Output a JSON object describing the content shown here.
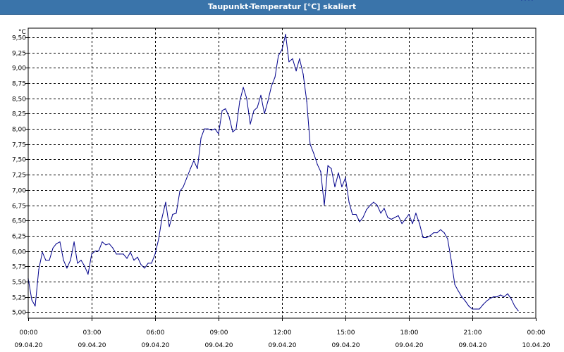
{
  "window": {
    "title": "Taupunkt-Temperatur [°C] skaliert"
  },
  "colors": {
    "titlebar": "#3a74aa",
    "line": "#00008b",
    "grid": "#000000"
  },
  "chart_data": {
    "type": "line",
    "title": "Taupunkt-Temperatur [°C] skaliert",
    "yunit": "°C",
    "ylim": [
      4.9,
      9.65
    ],
    "yticks": [
      "5,00",
      "5,25",
      "5,50",
      "5,75",
      "6,00",
      "6,25",
      "6,50",
      "6,75",
      "7,00",
      "7,25",
      "7,50",
      "7,75",
      "8,00",
      "8,25",
      "8,50",
      "8,75",
      "9,00",
      "9,25",
      "9,50"
    ],
    "ytick_values": [
      5.0,
      5.25,
      5.5,
      5.75,
      6.0,
      6.25,
      6.5,
      6.75,
      7.0,
      7.25,
      7.5,
      7.75,
      8.0,
      8.25,
      8.5,
      8.75,
      9.0,
      9.25,
      9.5
    ],
    "xlim_hours": [
      0,
      24
    ],
    "xticks": [
      {
        "time": "00:00",
        "date": "09.04.20",
        "hour": 0
      },
      {
        "time": "03:00",
        "date": "09.04.20",
        "hour": 3
      },
      {
        "time": "06:00",
        "date": "09.04.20",
        "hour": 6
      },
      {
        "time": "09:00",
        "date": "09.04.20",
        "hour": 9
      },
      {
        "time": "12:00",
        "date": "09.04.20",
        "hour": 12
      },
      {
        "time": "15:00",
        "date": "09.04.20",
        "hour": 15
      },
      {
        "time": "18:00",
        "date": "09.04.20",
        "hour": 18
      },
      {
        "time": "21:00",
        "date": "09.04.20",
        "hour": 21
      },
      {
        "time": "00:00",
        "date": "10.04.20",
        "hour": 24
      }
    ],
    "grid": true,
    "series": [
      {
        "hours": [
          0.0,
          0.17,
          0.33,
          0.5,
          0.67,
          0.83,
          1.0,
          1.17,
          1.33,
          1.5,
          1.67,
          1.83,
          2.0,
          2.17,
          2.33,
          2.5,
          2.67,
          2.83,
          3.0,
          3.17,
          3.33,
          3.5,
          3.67,
          3.83,
          4.0,
          4.17,
          4.33,
          4.5,
          4.67,
          4.83,
          5.0,
          5.17,
          5.33,
          5.5,
          5.67,
          5.83,
          6.0,
          6.17,
          6.33,
          6.5,
          6.67,
          6.83,
          7.0,
          7.17,
          7.33,
          7.5,
          7.67,
          7.83,
          8.0,
          8.17,
          8.33,
          8.5,
          8.67,
          8.83,
          9.0,
          9.17,
          9.33,
          9.5,
          9.67,
          9.83,
          10.0,
          10.17,
          10.33,
          10.5,
          10.67,
          10.83,
          11.0,
          11.17,
          11.33,
          11.5,
          11.67,
          11.83,
          12.0,
          12.17,
          12.33,
          12.5,
          12.67,
          12.83,
          13.0,
          13.17,
          13.33,
          13.5,
          13.67,
          13.83,
          14.0,
          14.17,
          14.33,
          14.5,
          14.67,
          14.83,
          15.0,
          15.17,
          15.33,
          15.5,
          15.67,
          15.83,
          16.0,
          16.17,
          16.33,
          16.5,
          16.67,
          16.83,
          17.0,
          17.17,
          17.33,
          17.5,
          17.67,
          17.83,
          18.0,
          18.17,
          18.33,
          18.5,
          18.67,
          18.83,
          19.0,
          19.17,
          19.33,
          19.5,
          19.67,
          19.83,
          20.0,
          20.17,
          20.33,
          20.5,
          20.67,
          20.83,
          21.0,
          21.17,
          21.33,
          21.5,
          21.67,
          21.83,
          22.0,
          22.17,
          22.33,
          22.5,
          22.67,
          22.83,
          23.0,
          23.17,
          23.33,
          23.5,
          23.67,
          23.83
        ],
        "values": [
          5.55,
          5.2,
          5.1,
          5.7,
          5.98,
          5.85,
          5.85,
          6.05,
          6.12,
          6.15,
          5.85,
          5.72,
          5.85,
          6.15,
          5.8,
          5.85,
          5.75,
          5.62,
          5.95,
          6.0,
          6.0,
          6.15,
          6.1,
          6.12,
          6.05,
          5.95,
          5.95,
          5.95,
          5.88,
          5.98,
          5.85,
          5.9,
          5.78,
          5.72,
          5.8,
          5.8,
          5.95,
          6.2,
          6.55,
          6.8,
          6.4,
          6.6,
          6.62,
          6.98,
          7.05,
          7.2,
          7.35,
          7.48,
          7.35,
          7.85,
          8.0,
          8.0,
          7.98,
          8.0,
          7.92,
          8.3,
          8.33,
          8.2,
          7.95,
          8.0,
          8.45,
          8.68,
          8.5,
          8.08,
          8.3,
          8.35,
          8.55,
          8.25,
          8.45,
          8.7,
          8.85,
          9.2,
          9.3,
          9.55,
          9.1,
          9.15,
          8.95,
          9.15,
          8.9,
          8.45,
          7.75,
          7.6,
          7.42,
          7.3,
          6.75,
          7.4,
          7.35,
          7.05,
          7.28,
          7.05,
          7.2,
          6.8,
          6.6,
          6.6,
          6.48,
          6.55,
          6.68,
          6.75,
          6.8,
          6.75,
          6.62,
          6.7,
          6.55,
          6.52,
          6.55,
          6.58,
          6.45,
          6.52,
          6.6,
          6.45,
          6.62,
          6.45,
          6.22,
          6.22,
          6.25,
          6.3,
          6.3,
          6.35,
          6.3,
          6.2,
          5.85,
          5.45,
          5.35,
          5.25,
          5.18,
          5.1,
          5.05,
          5.05,
          5.05,
          5.12,
          5.18,
          5.22,
          5.25,
          5.25,
          5.28,
          5.25,
          5.3,
          5.22,
          5.1,
          5.02
        ]
      }
    ]
  }
}
